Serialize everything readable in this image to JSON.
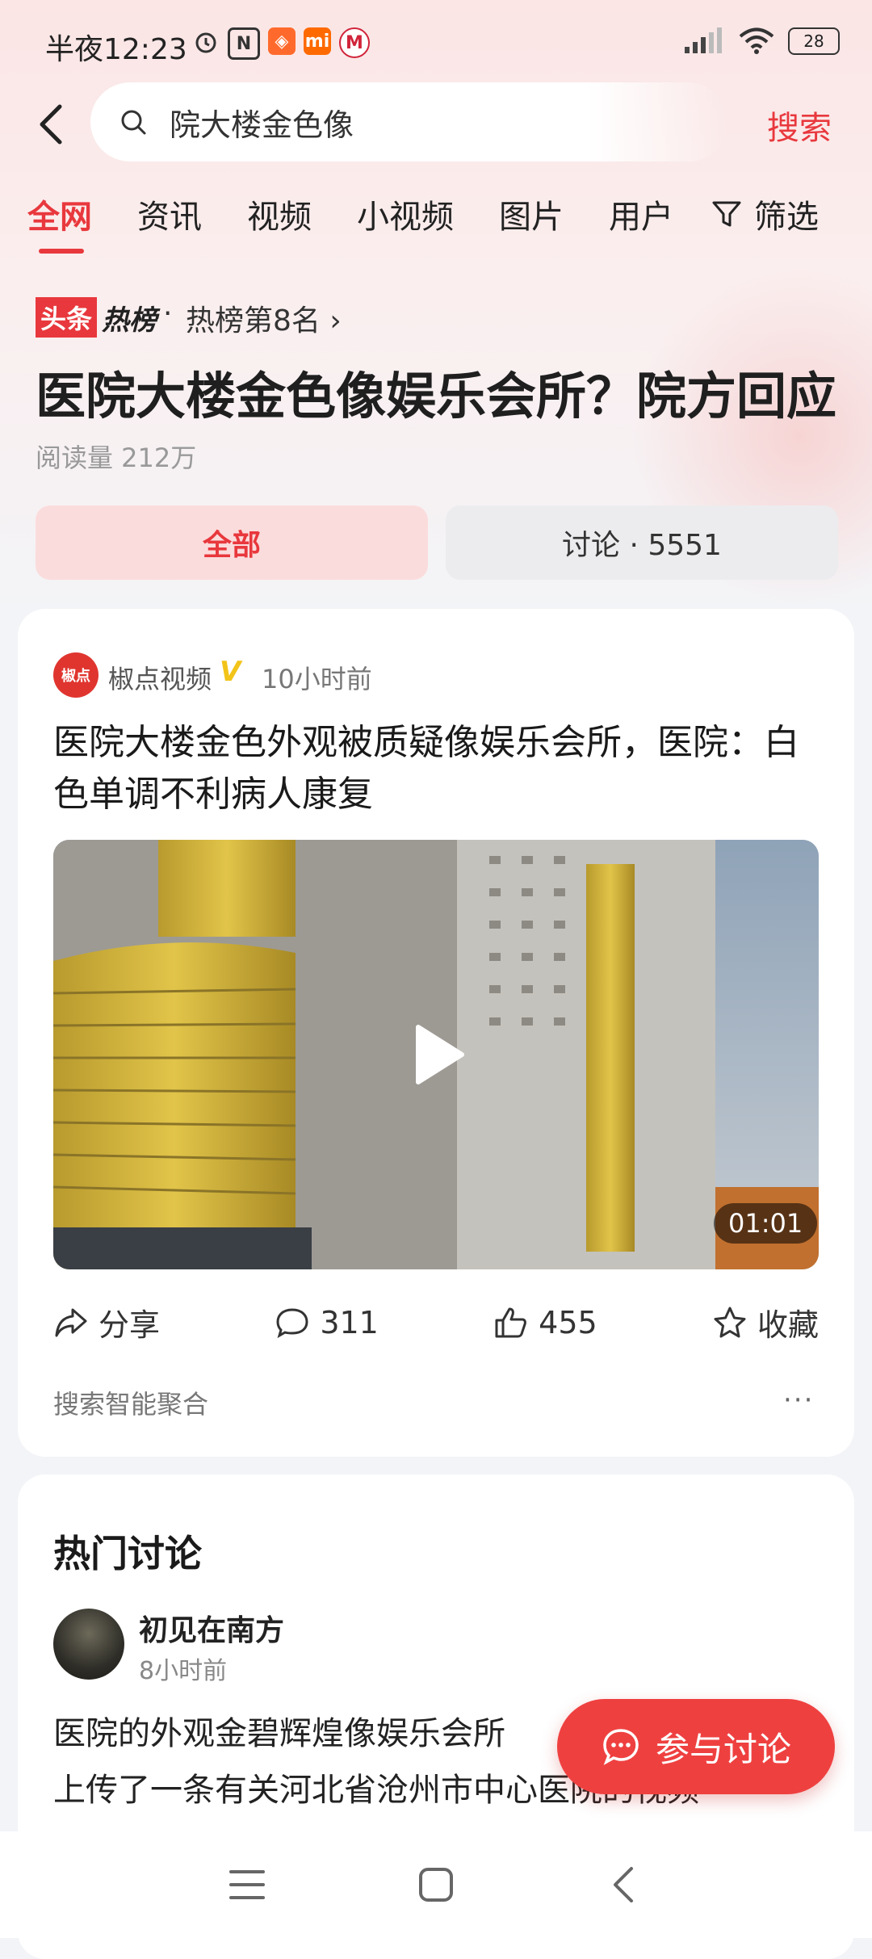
{
  "status_bar": {
    "time": "半夜12:23",
    "battery": "28"
  },
  "search": {
    "query": "院大楼金色像",
    "button": "搜索"
  },
  "tabs": [
    "全网",
    "资讯",
    "视频",
    "小视频",
    "图片",
    "用户"
  ],
  "filter_label": "筛选",
  "hot": {
    "logo_a": "头条",
    "logo_b": "热榜",
    "rank": "热榜第8名 ›"
  },
  "headline": "医院大楼金色像娱乐会所？院方回应",
  "reads": "阅读量 212万",
  "segments": {
    "all": "全部",
    "discussion": "讨论 · 5551"
  },
  "post": {
    "avatar_text": "椒点",
    "author": "椒点视频",
    "badge": "V",
    "time": "10小时前",
    "title": "医院大楼金色外观被质疑像娱乐会所，医院：白色单调不利病人康复",
    "duration": "01:01",
    "actions": {
      "share": "分享",
      "comments": "311",
      "likes": "455",
      "favorite": "收藏"
    },
    "source": "搜索智能聚合",
    "more": "···"
  },
  "discussion": {
    "title": "热门讨论",
    "user": "初见在南方",
    "time": "8小时前",
    "text_line1": "医院的外观金碧辉煌像娱乐会所",
    "text_line2": "上传了一条有关河北省沧州市中心医院的视频"
  },
  "join_button": "参与讨论",
  "colors": {
    "accent": "#e8383d",
    "join": "#ef4040"
  }
}
